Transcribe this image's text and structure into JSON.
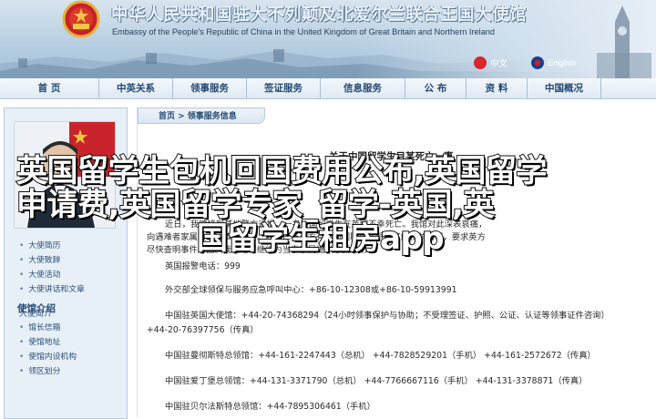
{
  "header": {
    "title_cn": "中华人民共和国驻大不列颠及北爱尔兰联合王国大使馆",
    "title_en": "Embassy of the People's Republic of China in the United Kingdom of Great Britain and Northern Ireland",
    "lang_cn": "中文",
    "lang_en": "English",
    "brand_red": "#c8202a"
  },
  "nav": {
    "items": [
      "首  页",
      "中英关系",
      "领事服务",
      "签证服务",
      "信息服务",
      "公  布",
      "资  料",
      "中国概况"
    ]
  },
  "sidebar": {
    "caption": "大使简介",
    "group1": [
      "大使简历",
      "大使致辞",
      "大使活动",
      "大使讲话和文章"
    ],
    "group2_title": "使馆介绍",
    "group2": [
      "馆长信箱",
      "使馆地址",
      "使馆内设机构",
      "领区划分"
    ]
  },
  "main": {
    "breadcrumb": "首页 > 领事服务信息",
    "article_title": "关于中国留学生目某死亡一事",
    "paragraphs": [
      "近日，我馆接到某地警方通报，一名中国留学生在英国不幸死亡。我馆对此深表哀痛，",
      "向遇难者家属致以诚挚的慰问。我馆已与英方有关部门取得联系，了解相关情况，要求英方",
      "尽快查明事件原因。我馆还将继续为当事家属提供必要协助。",
      "英国报警电话：999",
      "外交部全球领保与服务应急呼叫中心：+86-10-12308或+86-10-59913991",
      "中国驻英国大使馆：+44-20-74368294（24小时领事保护与协助；不受理签证、护照、公证、认证等领事证件咨询）",
      "+44-20-76397756（传真）",
      "中国驻曼彻斯特总领馆：+44-161-2247443（总机）  +44-7828529201（手机）  +44-161-2572672（传真）",
      "中国驻爱丁堡总领馆：+44-131-3371790（总机）  +44-7766667116（手机）  +44-131-3378871（传真）",
      "中国驻贝尔法斯特总领馆：+44-7895306461（手机）"
    ]
  },
  "overlay": {
    "line1": "英国留学生包机回国费用公布,英国留学",
    "line2": "申请费,英国留学专家_留学-英国,英",
    "line3": "国留学生租房app"
  }
}
